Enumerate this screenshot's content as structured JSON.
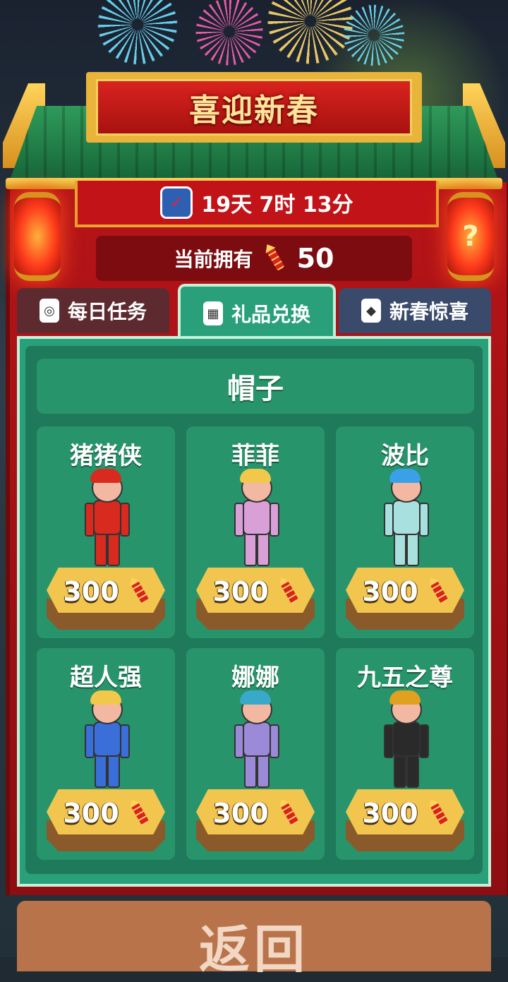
{
  "header": {
    "title": "喜迎新春",
    "timer": "19天 7时 13分",
    "help_glyph": "?"
  },
  "currency": {
    "label": "当前拥有",
    "amount": "50",
    "icon": "firecracker-icon"
  },
  "tabs": [
    {
      "label": "每日任务",
      "icon": "lantern-icon",
      "active": false
    },
    {
      "label": "礼品兑换",
      "icon": "gift-icon",
      "active": true
    },
    {
      "label": "新春惊喜",
      "icon": "red-packet-icon",
      "active": false
    }
  ],
  "section": {
    "title": "帽子"
  },
  "items": [
    {
      "name": "猪猪侠",
      "price": "300",
      "hair": "#d82a1f",
      "suit": "#d82a1f"
    },
    {
      "name": "菲菲",
      "price": "300",
      "hair": "#f2c84a",
      "suit": "#d9a0d8"
    },
    {
      "name": "波比",
      "price": "300",
      "hair": "#3aa0e8",
      "suit": "#a8e0e0"
    },
    {
      "name": "超人强",
      "price": "300",
      "hair": "#f2c84a",
      "suit": "#3a6ed8"
    },
    {
      "name": "娜娜",
      "price": "300",
      "hair": "#3aa8c8",
      "suit": "#9a8ad8"
    },
    {
      "name": "九五之尊",
      "price": "300",
      "hair": "#e0a020",
      "suit": "#2a2a2a"
    }
  ],
  "footer": {
    "back_label": "返回"
  },
  "colors": {
    "panel_green": "#2aa07a",
    "frame_red": "#b61418",
    "gold": "#e8b43a"
  }
}
